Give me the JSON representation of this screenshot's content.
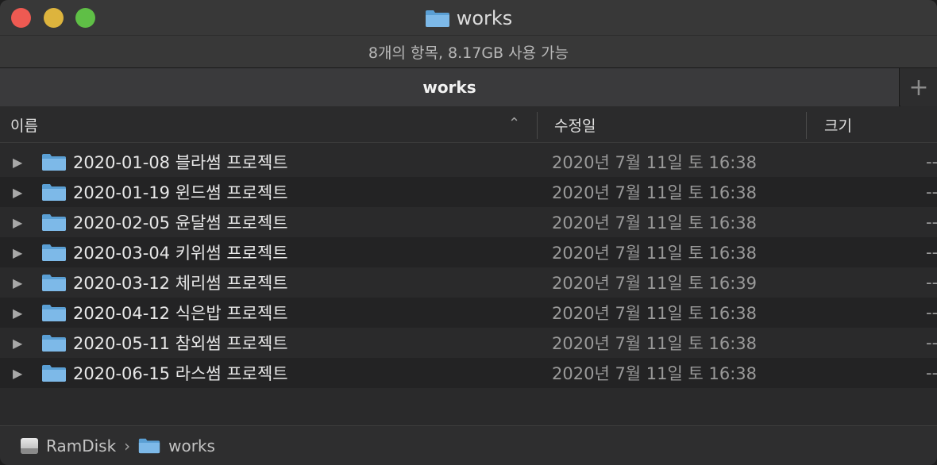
{
  "window": {
    "title": "works",
    "status": "8개의 항목, 8.17GB 사용 가능"
  },
  "tabs": [
    {
      "label": "works"
    }
  ],
  "tab_add_label": "+",
  "columns": {
    "name": "이름",
    "date": "수정일",
    "size": "크기"
  },
  "rows": [
    {
      "name": "2020-01-08 블라썸 프로젝트",
      "date": "2020년 7월 11일 토 16:38",
      "size": "--"
    },
    {
      "name": "2020-01-19 윈드썸 프로젝트",
      "date": "2020년 7월 11일 토 16:38",
      "size": "--"
    },
    {
      "name": "2020-02-05 윤달썸 프로젝트",
      "date": "2020년 7월 11일 토 16:38",
      "size": "--"
    },
    {
      "name": "2020-03-04 키위썸 프로젝트",
      "date": "2020년 7월 11일 토 16:38",
      "size": "--"
    },
    {
      "name": "2020-03-12 체리썸 프로젝트",
      "date": "2020년 7월 11일 토 16:39",
      "size": "--"
    },
    {
      "name": "2020-04-12 식은밥 프로젝트",
      "date": "2020년 7월 11일 토 16:38",
      "size": "--"
    },
    {
      "name": "2020-05-11 참외썸 프로젝트",
      "date": "2020년 7월 11일 토 16:38",
      "size": "--"
    },
    {
      "name": "2020-06-15 라스썸 프로젝트",
      "date": "2020년 7월 11일 토 16:38",
      "size": "--"
    }
  ],
  "pathbar": {
    "crumbs": [
      {
        "label": "RamDisk",
        "icon": "disk-icon"
      },
      {
        "label": "works",
        "icon": "folder-icon"
      }
    ]
  },
  "colors": {
    "folder": "#6aaee0",
    "close": "#ee5a52",
    "minimize": "#ddb43d",
    "maximize": "#5fbf46"
  }
}
